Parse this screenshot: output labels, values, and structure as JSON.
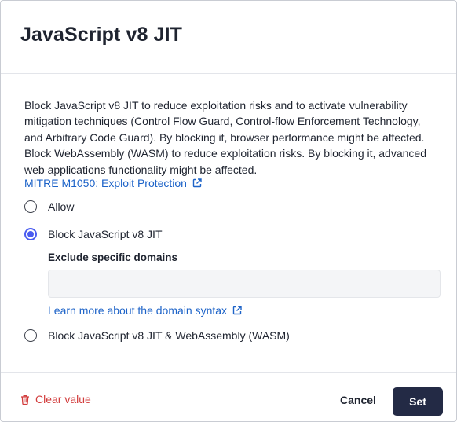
{
  "dialog": {
    "title": "JavaScript v8 JIT",
    "description": "Block JavaScript v8 JIT to reduce exploitation risks and to activate vulnerability mitigation techniques (Control Flow Guard, Control-flow Enforcement Technology, and Arbitrary Code Guard). By blocking it, browser performance might be affected. Block WebAssembly (WASM) to reduce exploitation risks. By blocking it, advanced web applications functionality might be affected.",
    "reference_link": "MITRE M1050: Exploit Protection",
    "options": [
      {
        "label": "Allow",
        "selected": false
      },
      {
        "label": "Block JavaScript v8 JIT",
        "selected": true
      },
      {
        "label": "Block JavaScript v8 JIT & WebAssembly (WASM)",
        "selected": false
      }
    ],
    "exclude": {
      "label": "Exclude specific domains",
      "value": "",
      "placeholder": "",
      "syntax_link": "Learn more about the domain syntax"
    }
  },
  "footer": {
    "clear_label": "Clear value",
    "cancel_label": "Cancel",
    "set_label": "Set"
  },
  "colors": {
    "accent": "#4a5cf0",
    "link": "#1d63c8",
    "danger": "#d23c3c",
    "primary_button": "#232a45"
  },
  "icons": {
    "external_link": "external-link-icon",
    "trash": "trash-icon"
  }
}
